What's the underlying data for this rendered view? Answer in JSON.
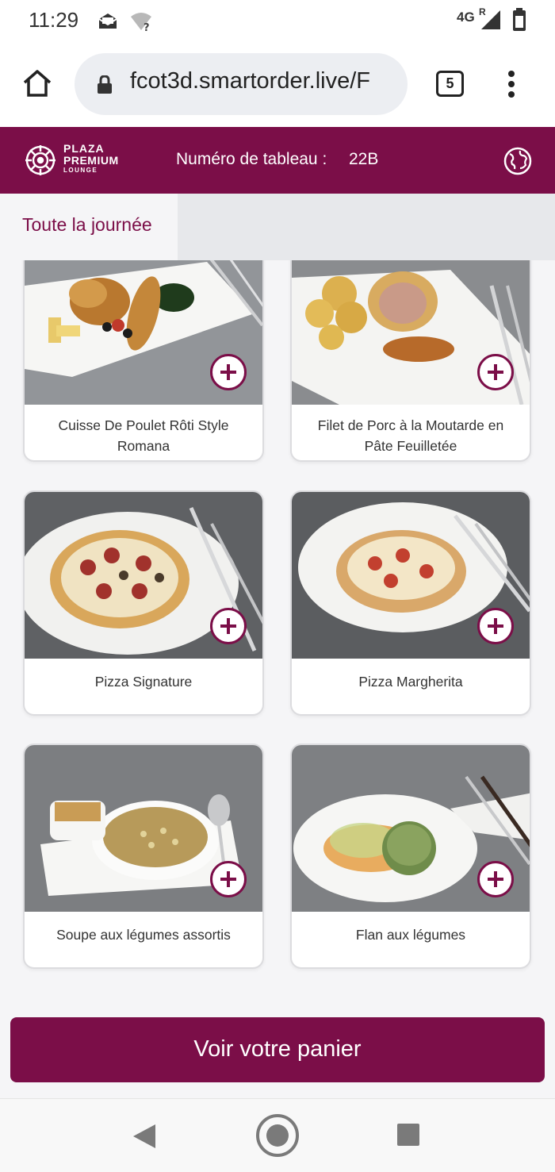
{
  "status_bar": {
    "time": "11:29",
    "network": "4G",
    "roaming": "R",
    "icons": [
      "mail-icon",
      "wifi-question-icon",
      "signal-icon",
      "battery-icon"
    ]
  },
  "browser": {
    "url": "fcot3d.smartorder.live/F",
    "tab_count": "5",
    "icons": [
      "home-icon",
      "lock-icon",
      "menu-dots-icon"
    ]
  },
  "header": {
    "logo_line1": "PLAZA",
    "logo_line2": "PREMIUM",
    "logo_line3": "LOUNGE",
    "table_label": "Numéro de tableau :",
    "table_number": "22B",
    "icons": [
      "globe-icon"
    ]
  },
  "categories": [
    {
      "label": "Toute la journée",
      "active": true
    }
  ],
  "menu_items": [
    {
      "name": "Cuisse De Poulet Rôti Style Romana",
      "line1": "Cuisse De Poulet Rôti Style",
      "line2": "Romana",
      "image": "roast-chicken"
    },
    {
      "name": "Filet de Porc à la Moutarde en Pâte Feuilletée",
      "line1": "Filet de Porc à la Moutarde en",
      "line2": "Pâte Feuilletée",
      "image": "pork-puff-pastry"
    },
    {
      "name": "Pizza Signature",
      "line1": "Pizza Signature",
      "line2": "",
      "image": "pizza-signature"
    },
    {
      "name": "Pizza Margherita",
      "line1": "Pizza Margherita",
      "line2": "",
      "image": "pizza-margherita"
    },
    {
      "name": "Soupe aux légumes assortis",
      "line1": "Soupe aux légumes assortis",
      "line2": "",
      "image": "vegetable-soup"
    },
    {
      "name": "Flan aux légumes",
      "line1": "Flan aux légumes",
      "line2": "",
      "image": "vegetable-flan"
    }
  ],
  "cart": {
    "label": "Voir votre panier"
  },
  "colors": {
    "brand": "#7b0e48",
    "background": "#f5f5f7",
    "category_bar": "#e7e8eb"
  },
  "nav": {
    "icons": [
      "back-icon",
      "home-circle-icon",
      "recents-icon"
    ]
  }
}
